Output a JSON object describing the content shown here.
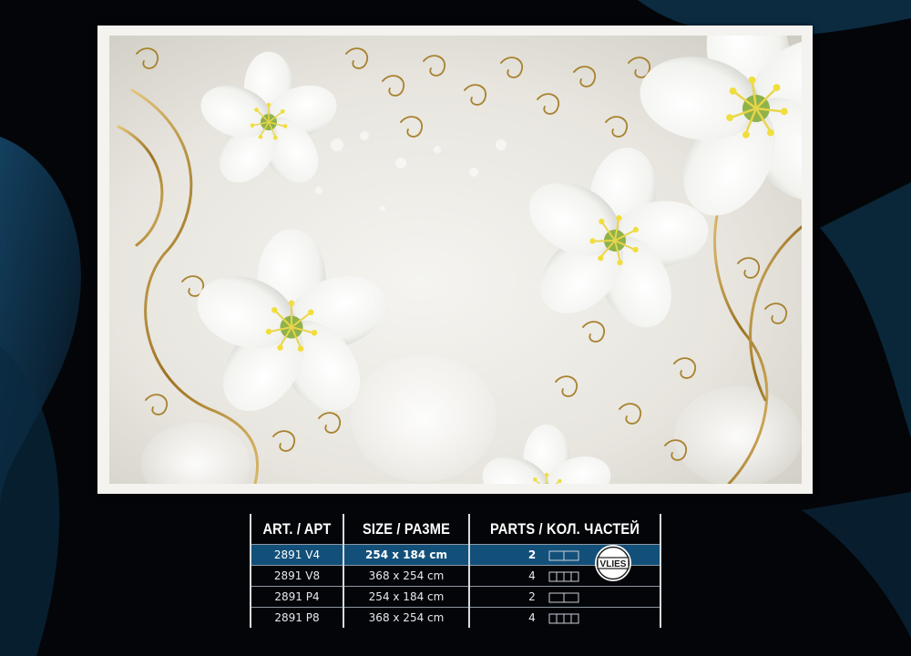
{
  "colors": {
    "background": "#030508",
    "wave": "#0d2f4a",
    "highlight_row": "#12507a",
    "gold": "#a8822f",
    "flower": "#ffffff"
  },
  "product": {
    "image_subject": "white-blossoms-with-gold-swirls",
    "badge_icon": "vlies-badge-icon",
    "badge_text": "VLIES"
  },
  "specs": {
    "headers": [
      "ART. / APT",
      "SIZE / PA3ME",
      "PARTS / KOЛ. ЧАСТЕЙ"
    ],
    "rows": [
      {
        "art": "2891 V4",
        "size": "254 x 184 cm",
        "parts": "2",
        "panels": 2,
        "highlighted": true
      },
      {
        "art": "2891 V8",
        "size": "368 x 254 cm",
        "parts": "4",
        "panels": 4,
        "highlighted": false
      },
      {
        "art": "2891 P4",
        "size": "254 x 184 cm",
        "parts": "2",
        "panels": 2,
        "highlighted": false
      },
      {
        "art": "2891 P8",
        "size": "368 x 254 cm",
        "parts": "4",
        "panels": 4,
        "highlighted": false
      }
    ]
  }
}
